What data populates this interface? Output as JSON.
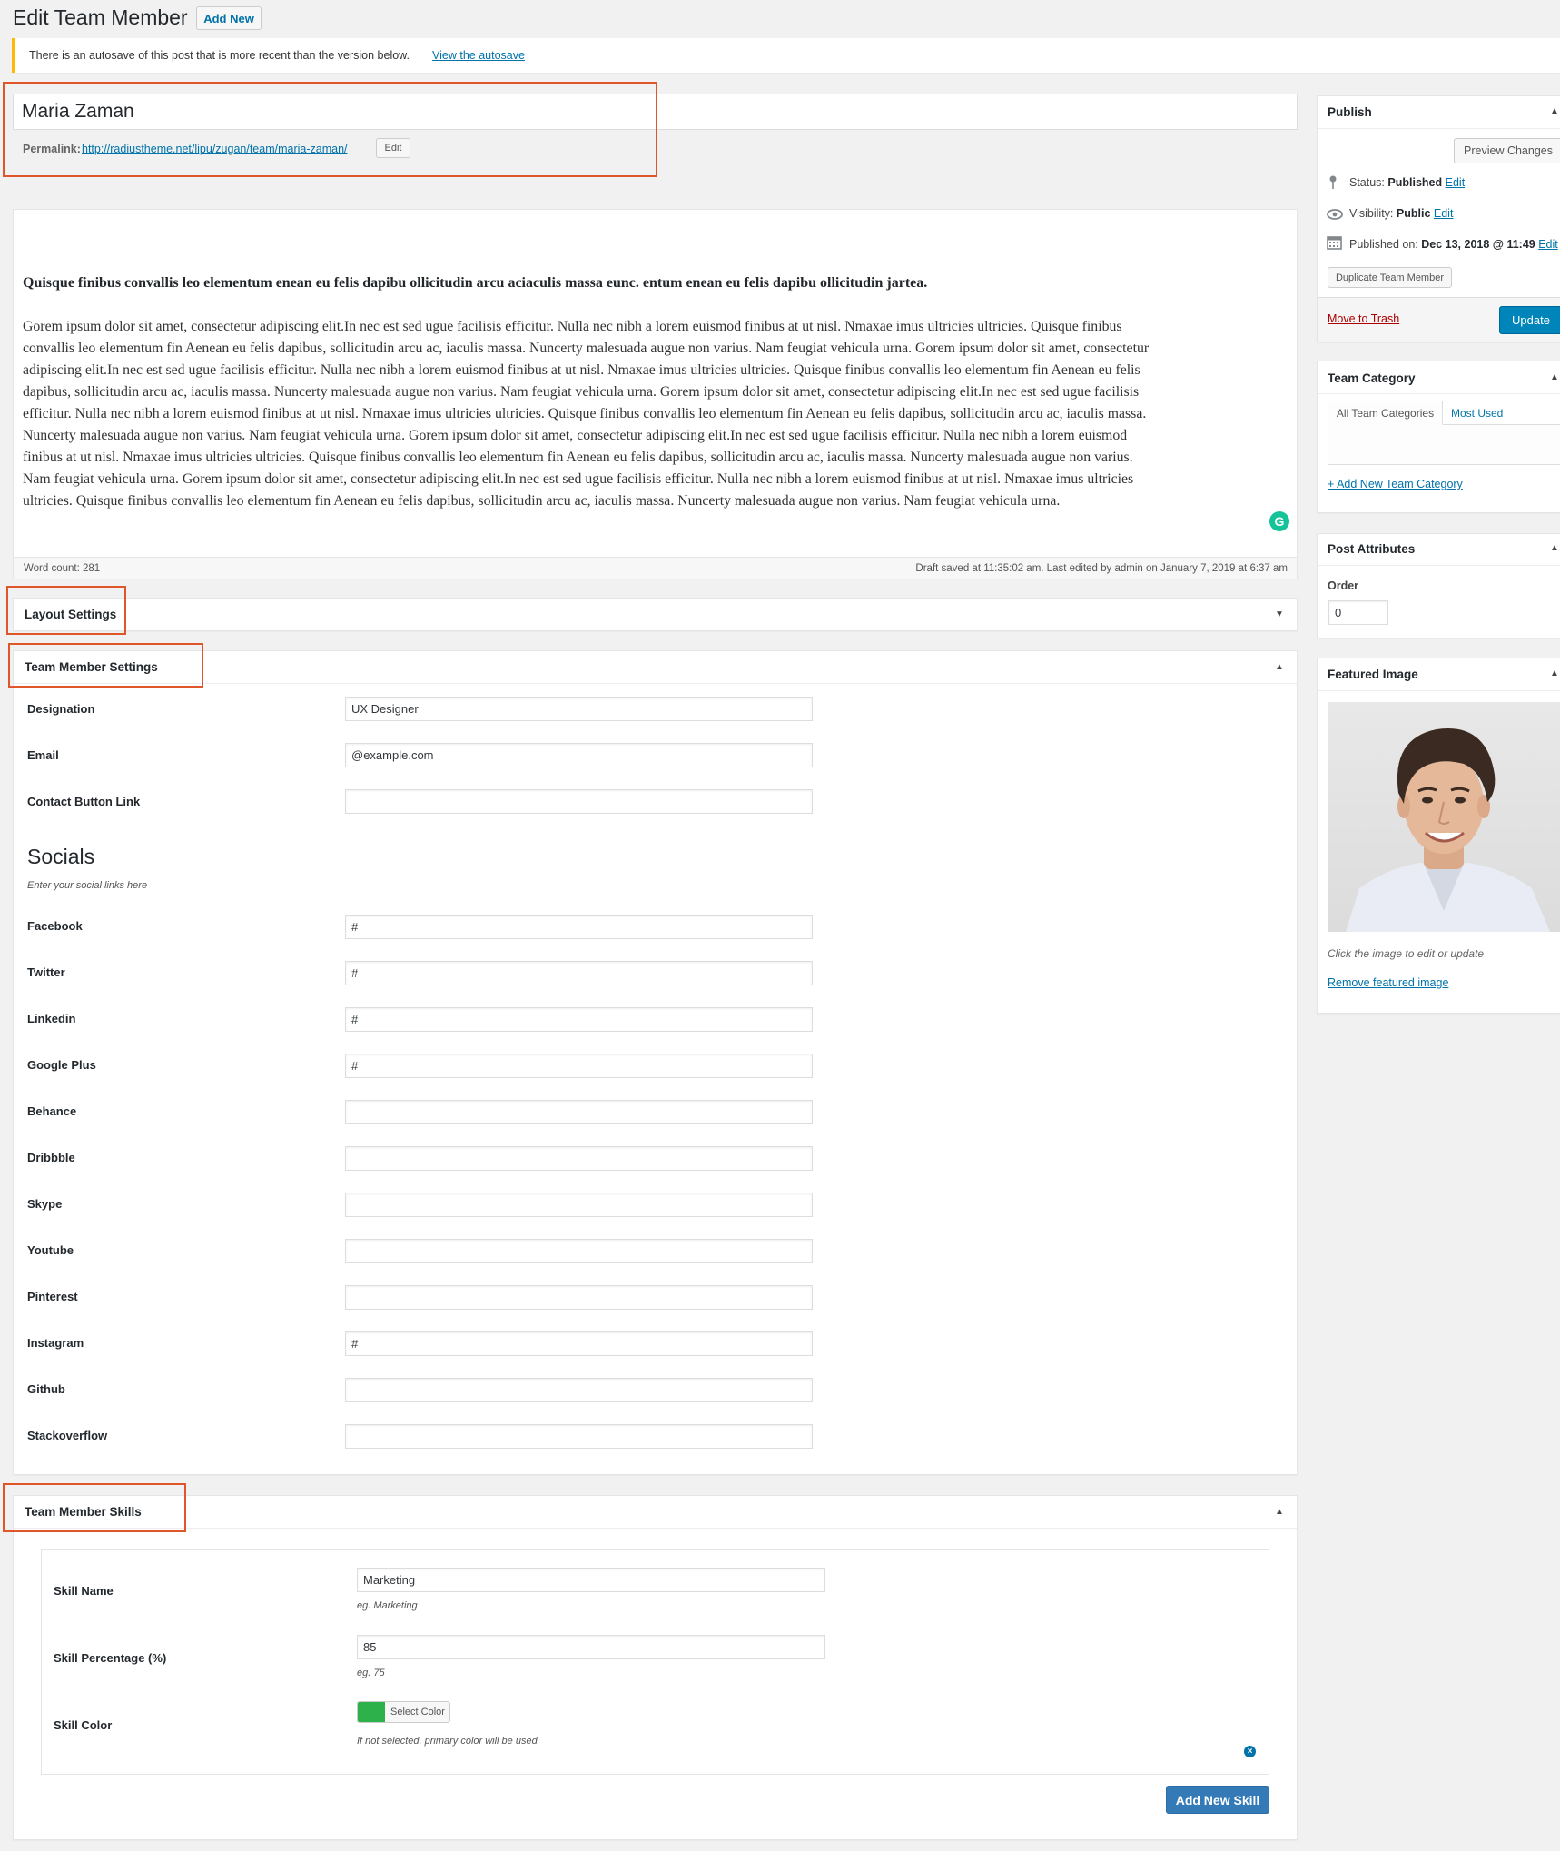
{
  "header": {
    "title": "Edit Team Member",
    "add_new": "Add New"
  },
  "notice": {
    "text": "There is an autosave of this post that is more recent than the version below.",
    "link": "View the autosave"
  },
  "post": {
    "title": "Maria Zaman",
    "permalink_label": "Permalink:",
    "permalink_url": "http://radiustheme.net/lipu/zugan/team/maria-zaman/",
    "edit_button": "Edit"
  },
  "editor": {
    "heading": "Quisque finibus convallis leo elementum enean eu felis dapibu ollicitudin arcu aciaculis massa eunc. entum enean eu felis dapibu ollicitudin jartea.",
    "lines": [
      "Gorem ipsum dolor sit amet, consectetur adipiscing elit.In nec est sed ugue facilisis efficitur. Nulla nec nibh a lorem euismod finibus at ut nisl. Nmaxae imus ultricies ultricies. Quisque finibus",
      "convallis leo elementum fin Aenean eu felis dapibus, sollicitudin arcu ac, iaculis massa. Nuncerty malesuada augue non varius. Nam feugiat vehicula urna. Gorem ipsum dolor sit amet, consectetur",
      "adipiscing elit.In nec est sed ugue facilisis efficitur. Nulla nec nibh a lorem euismod finibus at ut nisl. Nmaxae imus ultricies ultricies. Quisque finibus convallis leo elementum fin Aenean eu felis",
      "dapibus, sollicitudin arcu ac, iaculis massa. Nuncerty malesuada augue non varius. Nam feugiat vehicula urna. Gorem ipsum dolor sit amet, consectetur adipiscing elit.In nec est sed ugue facilisis",
      "efficitur. Nulla nec nibh a lorem euismod finibus at ut nisl. Nmaxae imus ultricies ultricies. Quisque finibus convallis leo elementum fin Aenean eu felis dapibus, sollicitudin arcu ac, iaculis massa.",
      "Nuncerty malesuada augue non varius. Nam feugiat vehicula urna. Gorem ipsum dolor sit amet, consectetur adipiscing elit.In nec est sed ugue facilisis efficitur. Nulla nec nibh a lorem euismod",
      "finibus at ut nisl. Nmaxae imus ultricies ultricies. Quisque finibus convallis leo elementum fin Aenean eu felis dapibus, sollicitudin arcu ac, iaculis massa. Nuncerty malesuada augue non varius.",
      "Nam feugiat vehicula urna. Gorem ipsum dolor sit amet, consectetur adipiscing elit.In nec est sed ugue facilisis efficitur. Nulla nec nibh a lorem euismod finibus at ut nisl. Nmaxae imus ultricies",
      "ultricies. Quisque finibus convallis leo elementum fin Aenean eu felis dapibus, sollicitudin arcu ac, iaculis massa. Nuncerty malesuada augue non varius. Nam feugiat vehicula urna."
    ],
    "word_count": "Word count: 281",
    "draft_status": "Draft saved at 11:35:02 am. Last edited by admin on January 7, 2019 at 6:37 am"
  },
  "layout_settings": {
    "title": "Layout Settings"
  },
  "team_member_settings": {
    "title": "Team Member Settings",
    "designation_label": "Designation",
    "designation_value": "UX Designer",
    "email_label": "Email",
    "email_value": "@example.com",
    "contact_label": "Contact Button Link",
    "contact_value": "",
    "socials_heading": "Socials",
    "socials_desc": "Enter your social links here",
    "socials": [
      {
        "label": "Facebook",
        "value": "#"
      },
      {
        "label": "Twitter",
        "value": "#"
      },
      {
        "label": "Linkedin",
        "value": "#"
      },
      {
        "label": "Google Plus",
        "value": "#"
      },
      {
        "label": "Behance",
        "value": ""
      },
      {
        "label": "Dribbble",
        "value": ""
      },
      {
        "label": "Skype",
        "value": ""
      },
      {
        "label": "Youtube",
        "value": ""
      },
      {
        "label": "Pinterest",
        "value": ""
      },
      {
        "label": "Instagram",
        "value": "#"
      },
      {
        "label": "Github",
        "value": ""
      },
      {
        "label": "Stackoverflow",
        "value": ""
      }
    ]
  },
  "skills": {
    "title": "Team Member Skills",
    "name_label": "Skill Name",
    "name_value": "Marketing",
    "name_hint": "eg. Marketing",
    "pct_label": "Skill Percentage (%)",
    "pct_value": "85",
    "pct_hint": "eg. 75",
    "color_label": "Skill Color",
    "color_value": "#2db24b",
    "color_button": "Select Color",
    "color_hint": "If not selected, primary color will be used",
    "add_button": "Add New Skill"
  },
  "publish": {
    "title": "Publish",
    "preview": "Preview Changes",
    "status_label": "Status:",
    "status_value": "Published",
    "visibility_label": "Visibility:",
    "visibility_value": "Public",
    "published_label": "Published on:",
    "published_value": "Dec 13, 2018 @ 11:49",
    "edit": "Edit",
    "duplicate": "Duplicate Team Member",
    "trash": "Move to Trash",
    "update": "Update"
  },
  "category": {
    "title": "Team Category",
    "tab_all": "All Team Categories",
    "tab_most": "Most Used",
    "add_new": "+ Add New Team Category"
  },
  "attributes": {
    "title": "Post Attributes",
    "order_label": "Order",
    "order_value": "0"
  },
  "featured": {
    "title": "Featured Image",
    "hint": "Click the image to edit or update",
    "remove": "Remove featured image"
  }
}
